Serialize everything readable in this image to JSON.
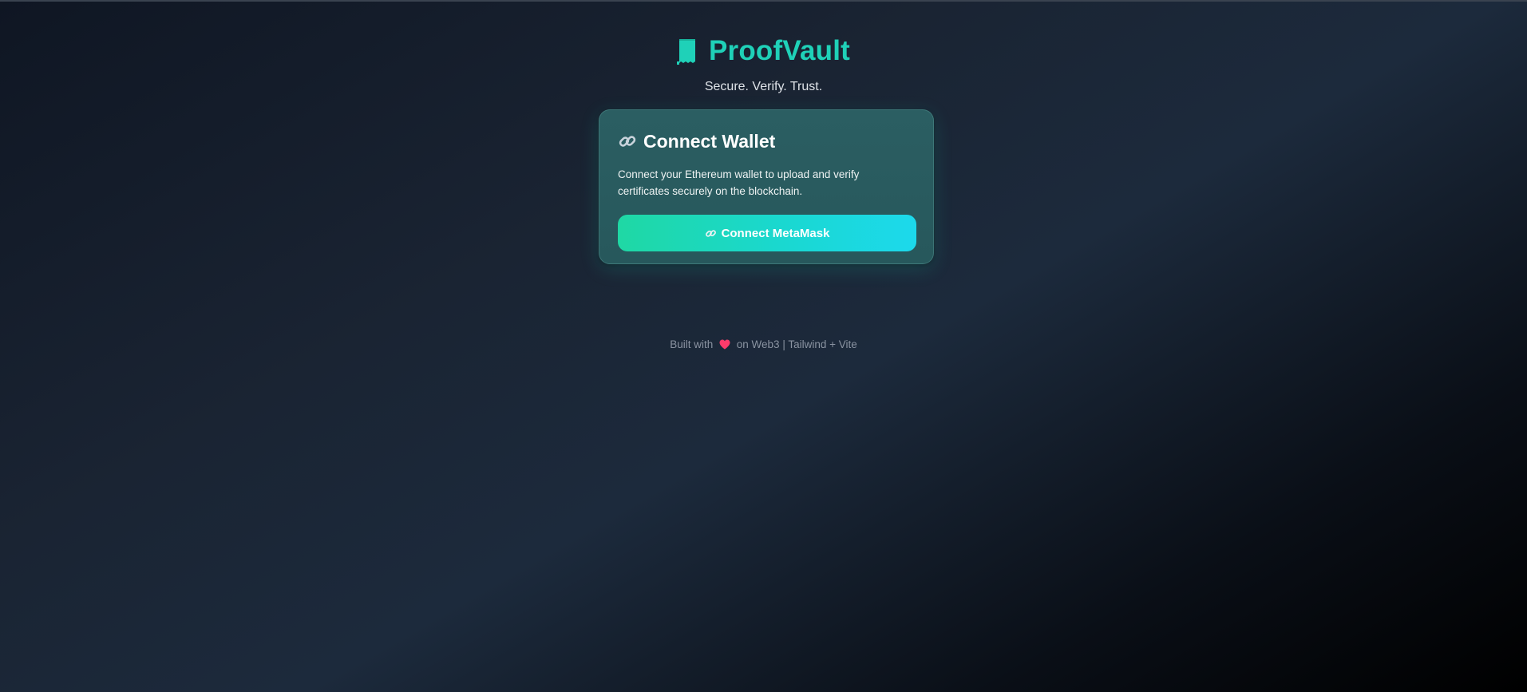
{
  "header": {
    "brand_icon": "receipt-icon",
    "title": "ProofVault",
    "tagline": "Secure. Verify. Trust."
  },
  "card": {
    "heading_icon": "link-icon",
    "title": "Connect Wallet",
    "description": "Connect your Ethereum wallet to upload and verify certificates securely on the blockchain.",
    "button": {
      "icon": "link-icon",
      "label": "Connect MetaMask"
    }
  },
  "footer": {
    "prefix": "Built with",
    "heart_icon": "heart-icon",
    "suffix": "on Web3 | Tailwind + Vite"
  },
  "colors": {
    "brand": "#1fd1b8",
    "card_bg": "#2b5e62",
    "button_start": "#1fd8a4",
    "button_end": "#1cd9ec",
    "heart": "#ff3b6b"
  }
}
